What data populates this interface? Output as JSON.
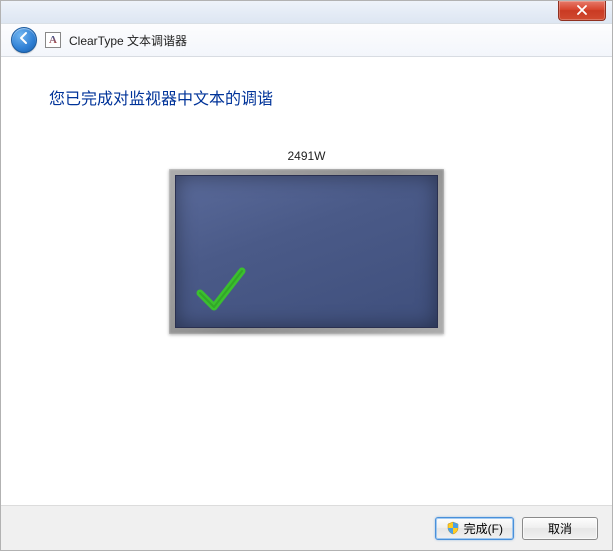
{
  "header": {
    "app_title": "ClearType 文本调谐器"
  },
  "content": {
    "heading": "您已完成对监视器中文本的调谐",
    "monitor_label": "2491W"
  },
  "footer": {
    "finish_label": "完成(F)",
    "cancel_label": "取消"
  }
}
